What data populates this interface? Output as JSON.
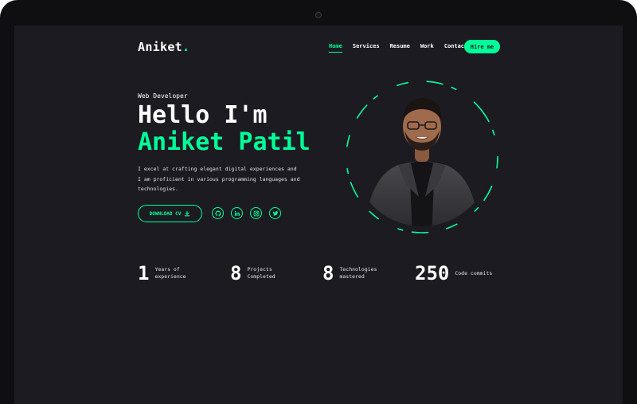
{
  "header": {
    "logo_text": "Aniket",
    "logo_dot": ".",
    "nav": [
      "Home",
      "Services",
      "Resume",
      "Work",
      "Contact"
    ],
    "active_nav": "Home",
    "hire_label": "Hire me"
  },
  "hero": {
    "role": "Web Developer",
    "greeting": "Hello I'm",
    "name": "Aniket Patil",
    "description": "I excel at crafting elegant digital experiences and I am proficient in various programming languages and technologies.",
    "cv_label": "DOWNLOAD CV",
    "socials": [
      "github-icon",
      "linkedin-icon",
      "instagram-icon",
      "twitter-icon"
    ]
  },
  "stats": [
    {
      "num": "1",
      "label": "Years of experience"
    },
    {
      "num": "8",
      "label": "Projects Completed"
    },
    {
      "num": "8",
      "label": "Technologies mastered"
    },
    {
      "num": "250",
      "label": "Code commits"
    }
  ],
  "colors": {
    "accent": "#00ff99",
    "background": "#1c1b22",
    "bezel": "#0f0f11"
  }
}
